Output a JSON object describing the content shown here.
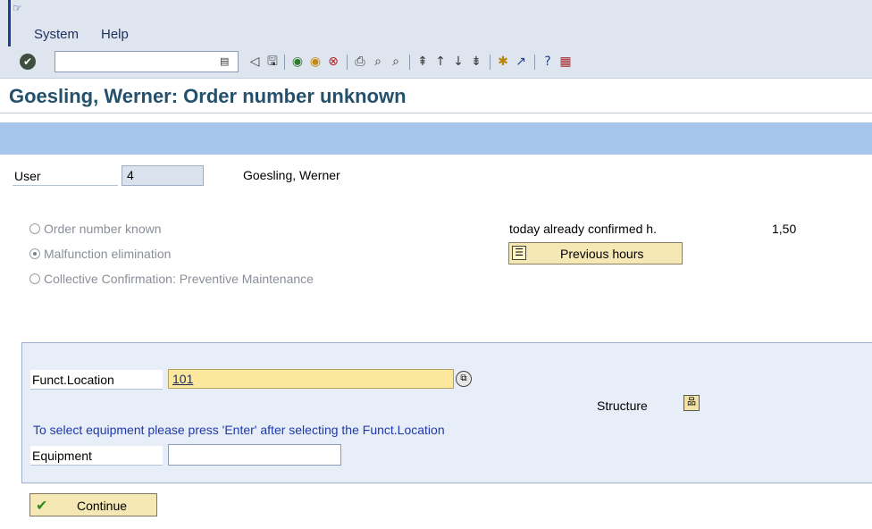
{
  "menubar": {
    "system_icon": "☞",
    "items": [
      {
        "label": "System",
        "accel": "S"
      },
      {
        "label": "Help",
        "accel": "H"
      }
    ]
  },
  "toolbar": {
    "enter_icon": "✔",
    "command_value": "",
    "icons": [
      "back",
      "save",
      "back-green",
      "exit",
      "cancel",
      "print",
      "find",
      "find-next",
      "first-page",
      "previous-page",
      "next-page",
      "last-page",
      "create-session",
      "shortcut",
      "help",
      "customize-layout"
    ]
  },
  "page": {
    "title": "Goesling, Werner: Order number unknown"
  },
  "user": {
    "label": "User",
    "value": "4",
    "name": "Goesling, Werner"
  },
  "options": [
    {
      "label": "Order number known",
      "checked": false
    },
    {
      "label": "Malfunction elimination",
      "checked": true
    },
    {
      "label": "Collective Confirmation: Preventive Maintenance",
      "checked": false
    }
  ],
  "confirmed": {
    "label": "today already confirmed h.",
    "value": "1,50"
  },
  "previous_hours": {
    "label": "Previous hours"
  },
  "functional_location": {
    "label": "Funct.Location",
    "value": "101"
  },
  "structure": {
    "label": "Structure"
  },
  "hint": "To select equipment please press 'Enter' after selecting the Funct.Location",
  "equipment": {
    "label": "Equipment",
    "value": ""
  },
  "continue": {
    "label": "Continue"
  },
  "colors": {
    "title": "#24506c",
    "band": "#a6c6ee",
    "button_bg": "#f5e8b5",
    "required_field": "#fbe89c",
    "hint": "#1f38ad"
  }
}
